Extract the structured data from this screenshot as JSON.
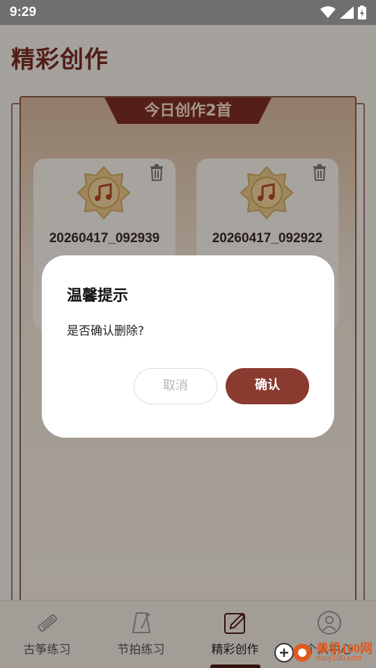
{
  "status": {
    "time": "9:29"
  },
  "page": {
    "title": "精彩创作"
  },
  "banner": {
    "label": "今日创作2首"
  },
  "works": [
    {
      "name": "20260417_092939"
    },
    {
      "name": "20260417_092922"
    }
  ],
  "tabs": [
    {
      "label": "古筝练习",
      "icon": "guzheng-icon"
    },
    {
      "label": "节拍练习",
      "icon": "metronome-icon"
    },
    {
      "label": "精彩创作",
      "icon": "edit-icon",
      "active": true
    },
    {
      "label": "个人中心",
      "icon": "profile-icon"
    }
  ],
  "dialog": {
    "title": "温馨提示",
    "message": "是否确认删除?",
    "cancel_label": "取消",
    "confirm_label": "确认"
  },
  "watermark": {
    "brand": "单机100网",
    "url": "danji100.com"
  },
  "colors": {
    "accent": "#8a3a2f",
    "title": "#7a2a22",
    "banner": "#7e2d25"
  }
}
